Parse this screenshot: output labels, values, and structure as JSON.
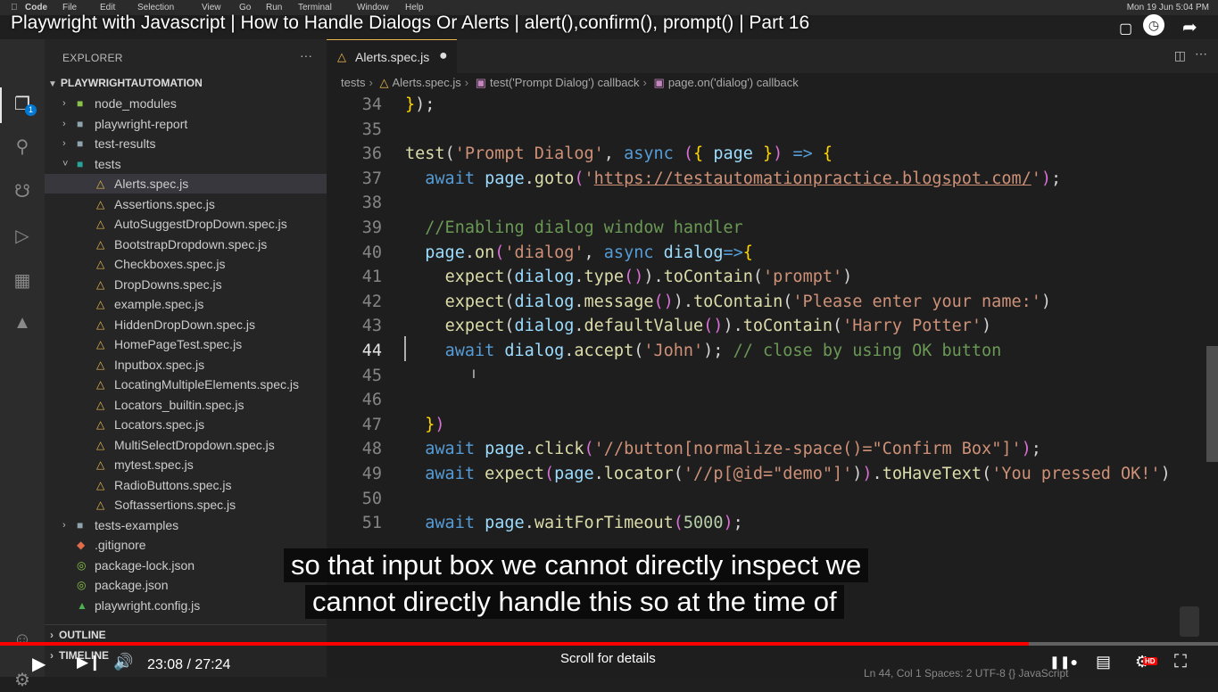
{
  "menubar": {
    "items": [
      "Code",
      "File",
      "Edit",
      "Selection",
      "View",
      "Go",
      "Run",
      "Terminal",
      "Window",
      "Help"
    ],
    "clock": "Mon 19 Jun  5:04 PM"
  },
  "video": {
    "title": "Playwright with Javascript | How to Handle Dialogs Or Alerts | alert(),confirm(), prompt() | Part 16",
    "time": "23:08 / 27:24",
    "progress": 0.8445,
    "scroll_hint": "Scroll for details",
    "hd": "HD",
    "caption_line1": "so that input box we cannot directly inspect we",
    "caption_line2": "cannot directly handle this so at the time of"
  },
  "activity": {
    "badge": "1"
  },
  "explorer": {
    "header": "EXPLORER",
    "more": "···",
    "workspace": "PLAYWRIGHTAUTOMATION",
    "items": [
      {
        "label": "node_modules",
        "kind": "folder-green",
        "depth": 1,
        "chev": "›"
      },
      {
        "label": "playwright-report",
        "kind": "folder",
        "depth": 1,
        "chev": "›"
      },
      {
        "label": "test-results",
        "kind": "folder",
        "depth": 1,
        "chev": "›"
      },
      {
        "label": "tests",
        "kind": "folder-teal",
        "depth": 1,
        "chev": "⌄"
      },
      {
        "label": "Alerts.spec.js",
        "kind": "flask",
        "depth": 2,
        "selected": true
      },
      {
        "label": "Assertions.spec.js",
        "kind": "flask",
        "depth": 2
      },
      {
        "label": "AutoSuggestDropDown.spec.js",
        "kind": "flask",
        "depth": 2
      },
      {
        "label": "BootstrapDropdown.spec.js",
        "kind": "flask",
        "depth": 2
      },
      {
        "label": "Checkboxes.spec.js",
        "kind": "flask",
        "depth": 2
      },
      {
        "label": "DropDowns.spec.js",
        "kind": "flask",
        "depth": 2
      },
      {
        "label": "example.spec.js",
        "kind": "flask",
        "depth": 2
      },
      {
        "label": "HiddenDropDown.spec.js",
        "kind": "flask",
        "depth": 2
      },
      {
        "label": "HomePageTest.spec.js",
        "kind": "flask",
        "depth": 2
      },
      {
        "label": "Inputbox.spec.js",
        "kind": "flask",
        "depth": 2
      },
      {
        "label": "LocatingMultipleElements.spec.js",
        "kind": "flask",
        "depth": 2
      },
      {
        "label": "Locators_builtin.spec.js",
        "kind": "flask",
        "depth": 2
      },
      {
        "label": "Locators.spec.js",
        "kind": "flask",
        "depth": 2
      },
      {
        "label": "MultiSelectDropdown.spec.js",
        "kind": "flask",
        "depth": 2
      },
      {
        "label": "mytest.spec.js",
        "kind": "flask",
        "depth": 2
      },
      {
        "label": "RadioButtons.spec.js",
        "kind": "flask",
        "depth": 2
      },
      {
        "label": "Softassertions.spec.js",
        "kind": "flask",
        "depth": 2
      },
      {
        "label": "tests-examples",
        "kind": "folder",
        "depth": 1,
        "chev": "›"
      },
      {
        "label": ".gitignore",
        "kind": "git",
        "depth": 1
      },
      {
        "label": "package-lock.json",
        "kind": "json",
        "depth": 1
      },
      {
        "label": "package.json",
        "kind": "json",
        "depth": 1
      },
      {
        "label": "playwright.config.js",
        "kind": "pw",
        "depth": 1
      }
    ],
    "outline": "OUTLINE",
    "timeline": "TIMELINE"
  },
  "editor": {
    "tab": "Alerts.spec.js",
    "breadcrumb": [
      "tests",
      "Alerts.spec.js",
      "test('Prompt Dialog') callback",
      "page.on('dialog') callback"
    ],
    "current_line": 44,
    "lines": [
      {
        "n": 34,
        "html": "<span class='y'>}</span>)<span>;</span>"
      },
      {
        "n": 35,
        "html": ""
      },
      {
        "n": 36,
        "html": "<span class='f'>test</span>(<span class='s'>'Prompt Dialog'</span>, <span class='k'>async</span> <span class='p'>(</span><span class='y'>{</span> <span class='v'>page</span> <span class='y'>}</span><span class='p'>)</span> <span class='k'>=&gt;</span> <span class='y'>{</span>"
      },
      {
        "n": 37,
        "html": "  <span class='k'>await</span> <span class='v'>page</span>.<span class='f'>goto</span><span class='p'>(</span><span class='s'>'</span><span class='u'>https://testautomationpractice.blogspot.com/</span><span class='s'>'</span><span class='p'>)</span>;"
      },
      {
        "n": 38,
        "html": ""
      },
      {
        "n": 39,
        "html": "  <span class='c'>//Enabling dialog window handler</span>"
      },
      {
        "n": 40,
        "html": "  <span class='v'>page</span>.<span class='f'>on</span><span class='p'>(</span><span class='s'>'dialog'</span>, <span class='k'>async</span> <span class='v'>dialog</span><span class='k'>=&gt;</span><span class='y'>{</span>"
      },
      {
        "n": 41,
        "html": "    <span class='f'>expect</span>(<span class='v'>dialog</span>.<span class='f'>type</span><span class='p'>()</span>).<span class='f'>toContain</span>(<span class='s'>'prompt'</span>)"
      },
      {
        "n": 42,
        "html": "    <span class='f'>expect</span>(<span class='v'>dialog</span>.<span class='f'>message</span><span class='p'>()</span>).<span class='f'>toContain</span>(<span class='s'>'Please enter your name:'</span>)"
      },
      {
        "n": 43,
        "html": "    <span class='f'>expect</span>(<span class='v'>dialog</span>.<span class='f'>defaultValue</span><span class='p'>()</span>).<span class='f'>toContain</span>(<span class='s'>'Harry Potter'</span>)"
      },
      {
        "n": 44,
        "html": "    <span class='k'>await</span> <span class='v'>dialog</span>.<span class='f'>accept</span>(<span class='s'>'John'</span>); <span class='c'>// close by using OK button</span>"
      },
      {
        "n": 45,
        "html": ""
      },
      {
        "n": 46,
        "html": ""
      },
      {
        "n": 47,
        "html": "  <span class='y'>}</span><span class='p'>)</span>"
      },
      {
        "n": 48,
        "html": "  <span class='k'>await</span> <span class='v'>page</span>.<span class='f'>click</span><span class='p'>(</span><span class='s'>'//button[normalize-space()=\"Confirm Box\"]'</span><span class='p'>)</span>;"
      },
      {
        "n": 49,
        "html": "  <span class='k'>await</span> <span class='f'>expect</span><span class='p'>(</span><span class='v'>page</span>.<span class='f'>locator</span>(<span class='s'>'//p[@id=\"demo\"]'</span>)<span class='p'>)</span>.<span class='f'>toHaveText</span>(<span class='s'>'You pressed OK!'</span>)"
      },
      {
        "n": 50,
        "html": ""
      },
      {
        "n": 51,
        "html": "  <span class='k'>await</span> <span class='v'>page</span>.<span class='f'>waitForTimeout</span><span class='p'>(</span><span class='n'>5000</span><span class='p'>)</span>;"
      }
    ]
  },
  "statusbar": {
    "text": "Ln 44, Col 1    Spaces: 2    UTF-8    {} JavaScript"
  }
}
